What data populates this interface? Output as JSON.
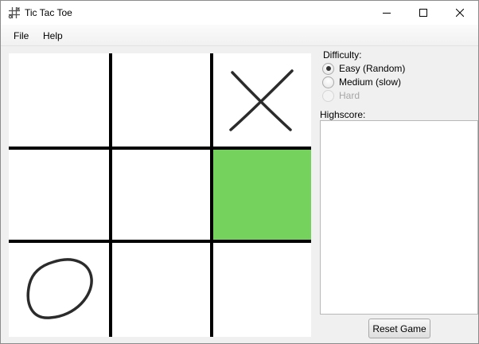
{
  "window": {
    "title": "Tic Tac Toe",
    "icon": "tic-tac-toe-grid-icon",
    "controls": [
      "minimize-icon",
      "maximize-icon",
      "close-icon"
    ]
  },
  "menu": {
    "file": "File",
    "help": "Help"
  },
  "board": {
    "rows": 3,
    "cols": 3,
    "cells": [
      [
        "",
        "",
        "X"
      ],
      [
        "",
        "",
        ""
      ],
      [
        "O",
        "",
        ""
      ]
    ],
    "highlighted_cell": {
      "row": 1,
      "col": 2
    },
    "highlight_color": "#75d35d",
    "line_color": "#000000",
    "mark_color": "#2b2b2b"
  },
  "difficulty": {
    "label": "Difficulty:",
    "options": [
      {
        "label": "Easy (Random)",
        "selected": true,
        "enabled": true
      },
      {
        "label": "Medium (slow)",
        "selected": false,
        "enabled": true
      },
      {
        "label": "Hard",
        "selected": false,
        "enabled": false
      }
    ]
  },
  "highscore": {
    "label": "Highscore:",
    "entries": []
  },
  "actions": {
    "reset_label": "Reset Game"
  }
}
